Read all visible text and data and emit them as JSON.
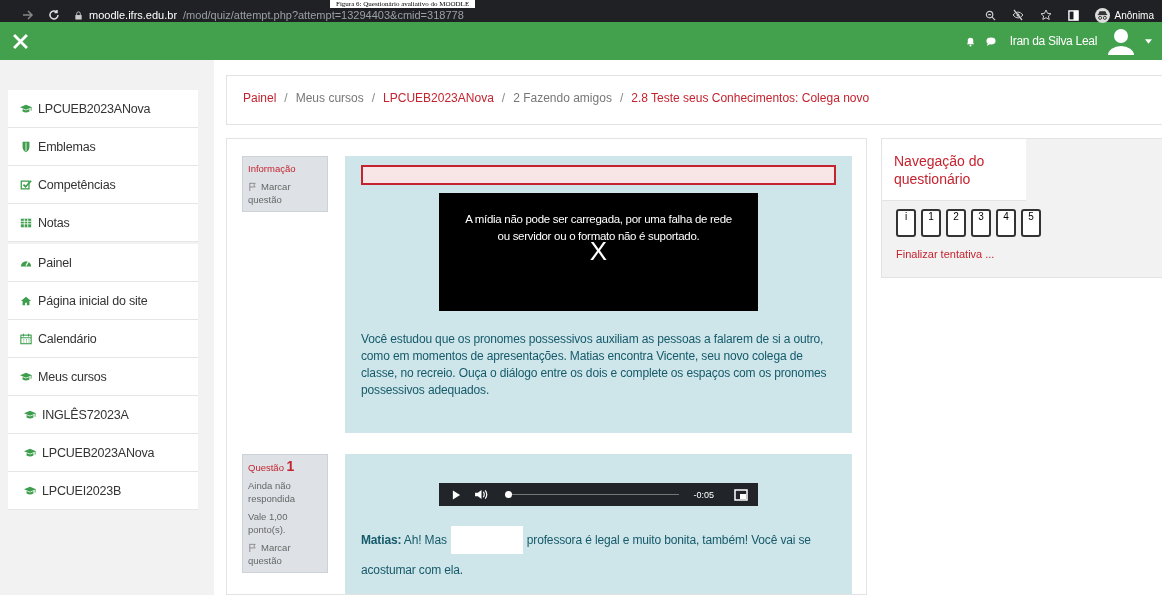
{
  "caption": "Figura 6: Questionário avaliativo do MOODLE",
  "browser": {
    "url_host": "moodle.ifrs.edu.br",
    "url_path": "/mod/quiz/attempt.php?attempt=13294403&cmid=318778",
    "profile": "Anônima"
  },
  "header": {
    "user_name": "Iran da Silva Leal"
  },
  "sidebar": {
    "groups": [
      [
        {
          "kind": "cap",
          "label": "LPCUEB2023ANova"
        },
        {
          "kind": "shield",
          "label": "Emblemas"
        },
        {
          "kind": "check",
          "label": "Competências"
        },
        {
          "kind": "table",
          "label": "Notas"
        }
      ],
      [
        {
          "kind": "gauge",
          "label": "Painel"
        },
        {
          "kind": "home",
          "label": "Página inicial do site"
        },
        {
          "kind": "calendar",
          "label": "Calendário"
        },
        {
          "kind": "cap",
          "label": "Meus cursos",
          "children": [
            {
              "kind": "cap",
              "label": "INGLÊS72023A"
            },
            {
              "kind": "cap",
              "label": "LPCUEB2023ANova"
            },
            {
              "kind": "cap",
              "label": "LPCUEI2023B"
            }
          ]
        }
      ]
    ]
  },
  "breadcrumb": [
    {
      "label": "Painel",
      "link": true
    },
    {
      "separator": "/",
      "label": "Meus cursos",
      "link": false
    },
    {
      "separator": "/",
      "label": "LPCUEB2023ANova",
      "link": true
    },
    {
      "separator": "/",
      "label": "2 Fazendo amigos",
      "link": false
    },
    {
      "separator": "/",
      "label": "2.8 Teste seus Conhecimentos: Colega novo",
      "link": true
    }
  ],
  "questions": [
    {
      "kind": "info",
      "title": "Informação",
      "flag": "Marcar questão",
      "media_error": "A mídia não pode ser carregada, por uma falha de rede ou servidor ou o formato não é suportado.",
      "media_close": "X",
      "text": "Você estudou que os pronomes possessivos auxiliam as pessoas a falarem de si a outro, como em momentos de apresentações. Matias encontra Vicente, seu novo colega de classe, no recreio. Ouça o diálogo entre os dois e complete os espaços com os pronomes possessivos adequados."
    },
    {
      "kind": "question",
      "title": "Questão",
      "number": "1",
      "status": "Ainda não respondida",
      "grade": "Vale 1,00 ponto(s).",
      "flag": "Marcar questão",
      "audio": {
        "level": 0,
        "time": "-0:05"
      },
      "text_before": "**Matias:** Ah! Mas",
      "text_after": "professora é legal e muito bonita, também! Você vai se",
      "text_continued": "acostumar com ela."
    }
  ],
  "navigation": {
    "title": "Navegação do questionário",
    "buttons": [
      "i",
      "1",
      "2",
      "3",
      "4",
      "5"
    ],
    "finish": "Finalizar tentativa ..."
  }
}
